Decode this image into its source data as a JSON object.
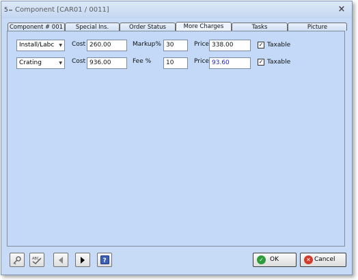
{
  "window": {
    "title": "Component [CAR01 / 0011]",
    "title_icon": "app-icon",
    "close_label": "×"
  },
  "tabs": [
    {
      "label": "Component # 001",
      "active": false
    },
    {
      "label": "Special Ins.",
      "active": false
    },
    {
      "label": "Order Status",
      "active": false
    },
    {
      "label": "More Charges",
      "active": true
    },
    {
      "label": "Tasks",
      "active": false
    },
    {
      "label": "Picture",
      "active": false
    }
  ],
  "charges": [
    {
      "type": "Install/Labc",
      "cost_label": "Cost",
      "cost": "260.00",
      "rate_label": "Markup%",
      "rate": "30",
      "price_label": "Price",
      "price": "338.00",
      "taxable": true,
      "taxable_label": "Taxable"
    },
    {
      "type": "Crating",
      "cost_label": "Cost",
      "cost": "936.00",
      "rate_label": "Fee %",
      "rate": "10",
      "price_label": "Price",
      "price": "93.60",
      "taxable": true,
      "taxable_label": "Taxable"
    }
  ],
  "toolbar": {
    "tools": [
      "key-icon",
      "spellcheck-icon",
      "previous-icon",
      "next-icon",
      "help-icon"
    ],
    "ok_label": "OK",
    "cancel_label": "Cancel"
  },
  "colors": {
    "background": "#c7dbf6",
    "panel": "#c3d9f7",
    "price_highlight": "#2222c8",
    "ok_icon": "#2e9b3c",
    "cancel_icon": "#d23a2a"
  }
}
